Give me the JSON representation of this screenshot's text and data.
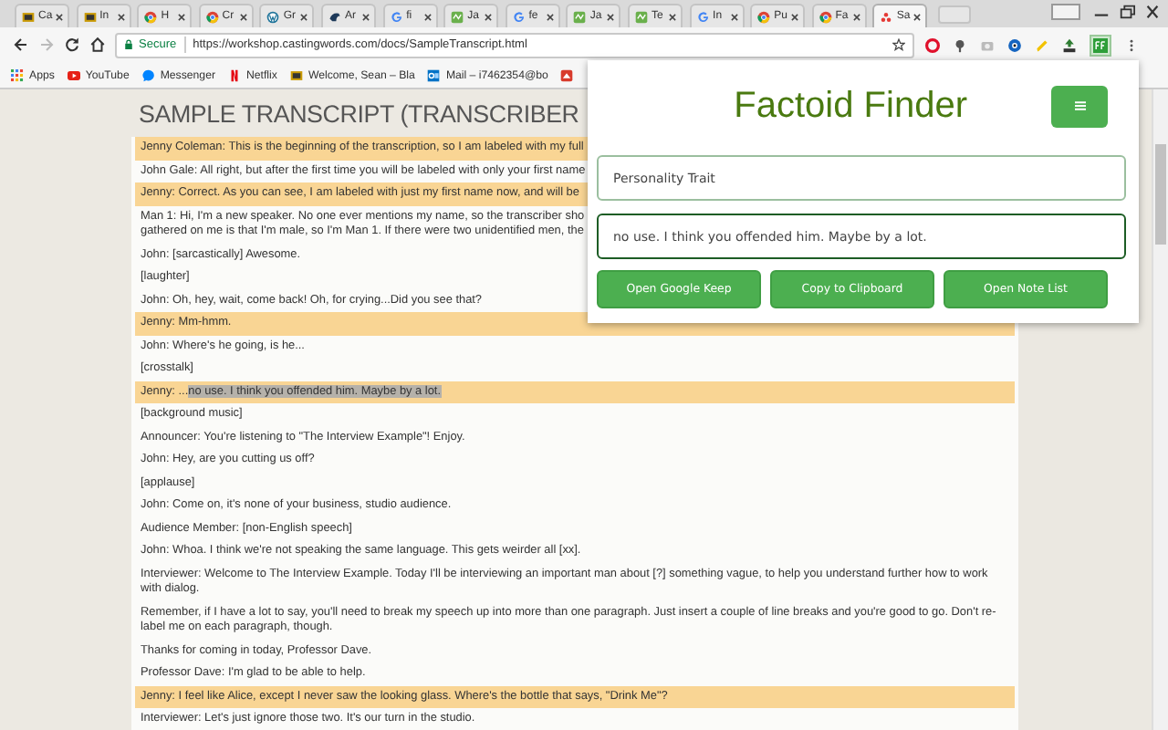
{
  "tabs": [
    {
      "title": "Ca",
      "selected": false
    },
    {
      "title": "In",
      "selected": false
    },
    {
      "title": "H",
      "selected": false
    },
    {
      "title": "Cr",
      "selected": false
    },
    {
      "title": "Gr",
      "selected": false
    },
    {
      "title": "Ar",
      "selected": false
    },
    {
      "title": "fi",
      "selected": false
    },
    {
      "title": "Ja",
      "selected": false
    },
    {
      "title": "fe",
      "selected": false
    },
    {
      "title": "Ja",
      "selected": false
    },
    {
      "title": "Te",
      "selected": false
    },
    {
      "title": "In",
      "selected": false
    },
    {
      "title": "Pu",
      "selected": false
    },
    {
      "title": "Fa",
      "selected": false
    },
    {
      "title": "Sa",
      "selected": true
    }
  ],
  "address": {
    "secure_label": "Secure",
    "url": "https://workshop.castingwords.com/docs/SampleTranscript.html"
  },
  "bookmarks": [
    {
      "label": "Apps"
    },
    {
      "label": "YouTube"
    },
    {
      "label": "Messenger"
    },
    {
      "label": "Netflix"
    },
    {
      "label": "Welcome, Sean – Bla"
    },
    {
      "label": "Mail – i7462354@bo"
    }
  ],
  "page": {
    "title": "SAMPLE TRANSCRIPT (TRANSCRIBER",
    "rows": [
      {
        "lines": [
          "Jenny Coleman: This is the beginning of the transcription, so I am labeled with my full"
        ],
        "highlighted": true
      },
      {
        "lines": [
          "John Gale: All right, but after the first time you will be labeled with only your first name"
        ],
        "highlighted": false
      },
      {
        "lines": [
          "Jenny: Correct. As you can see, I am labeled with just my first name now, and will be"
        ],
        "highlighted": true
      },
      {
        "lines": [
          "Man 1: Hi, I'm a new speaker. No one ever mentions my name, so the transcriber sho",
          "gathered on me is that I'm male, so I'm Man 1. If there were two unidentified men, the"
        ],
        "highlighted": false
      },
      {
        "lines": [
          "John: [sarcastically] Awesome."
        ],
        "highlighted": false
      },
      {
        "lines": [
          "[laughter]"
        ],
        "highlighted": false
      },
      {
        "lines": [
          "John: Oh, hey, wait, come back! Oh, for crying...Did you see that?"
        ],
        "highlighted": false
      },
      {
        "lines": [
          "Jenny: Mm-hmm."
        ],
        "highlighted": true
      },
      {
        "lines": [
          "John: Where's he going, is he..."
        ],
        "highlighted": false
      },
      {
        "lines": [
          "[crosstalk]"
        ],
        "highlighted": false
      },
      {
        "lines": [
          "Jenny: ..."
        ],
        "selection": "no use. I think you offended him. Maybe by a lot.",
        "highlighted": true
      },
      {
        "lines": [
          "[background music]"
        ],
        "highlighted": false
      },
      {
        "lines": [
          "Announcer: You're listening to \"The Interview Example\"! Enjoy."
        ],
        "highlighted": false
      },
      {
        "lines": [
          "John: Hey, are you cutting us off?"
        ],
        "highlighted": false
      },
      {
        "lines": [
          "[applause]"
        ],
        "highlighted": false
      },
      {
        "lines": [
          "John: Come on, it's none of your business, studio audience."
        ],
        "highlighted": false
      },
      {
        "lines": [
          "Audience Member: [non-English speech]"
        ],
        "highlighted": false
      },
      {
        "lines": [
          "John: Whoa. I think we're not speaking the same language. This gets weirder all [xx]."
        ],
        "highlighted": false
      },
      {
        "lines": [
          "Interviewer: Welcome to The Interview Example. Today I'll be interviewing an important man about [?] something vague, to help you understand further how to work",
          "with dialog."
        ],
        "highlighted": false
      },
      {
        "lines": [
          "Remember, if I have a lot to say, you'll need to break my speech up into more than one paragraph. Just insert a couple of line breaks and you're good to go. Don't re-",
          "label me on each paragraph, though."
        ],
        "highlighted": false
      },
      {
        "lines": [
          "Thanks for coming in today, Professor Dave."
        ],
        "highlighted": false
      },
      {
        "lines": [
          "Professor Dave: I'm glad to be able to help."
        ],
        "highlighted": false
      },
      {
        "lines": [
          "Jenny: I feel like Alice, except I never saw the looking glass. Where's the bottle that says, \"Drink Me\"?"
        ],
        "highlighted": true
      },
      {
        "lines": [
          "Interviewer: Let's just ignore those two. It's our turn in the studio."
        ],
        "highlighted": false
      }
    ]
  },
  "popup": {
    "title": "Factoid Finder",
    "tag_field": {
      "value": "Personality Trait"
    },
    "note_field": {
      "value": "no use. I think you offended him. Maybe by a lot."
    },
    "buttons": [
      "Open Google Keep",
      "Copy to Clipboard",
      "Open Note List"
    ]
  }
}
